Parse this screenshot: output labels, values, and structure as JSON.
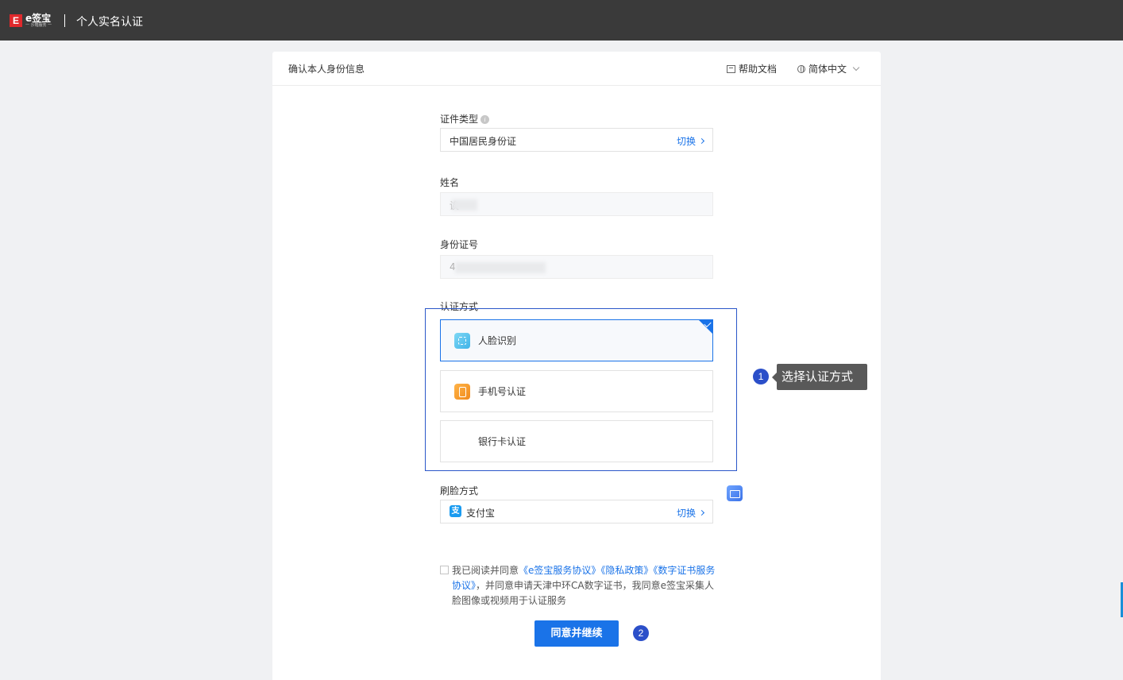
{
  "topbar": {
    "logo_mark": "E",
    "logo_name": "e签宝",
    "logo_sub": "一 沙箱服务 一",
    "title": "个人实名认证"
  },
  "card": {
    "title": "确认本人身份信息",
    "help_label": "帮助文档",
    "lang_label": "简体中文"
  },
  "form": {
    "id_type": {
      "label": "证件类型",
      "value": "中国居民身份证",
      "switch_label": "切换"
    },
    "name": {
      "label": "姓名",
      "value": "诶"
    },
    "id_number": {
      "label": "身份证号",
      "value": "4"
    },
    "auth_method": {
      "label": "认证方式",
      "options": [
        {
          "label": "人脸识别",
          "icon": "face-scan-icon",
          "selected": true
        },
        {
          "label": "手机号认证",
          "icon": "phone-icon",
          "selected": false
        },
        {
          "label": "银行卡认证",
          "icon": "bank-card-icon",
          "selected": false
        }
      ]
    },
    "face_method": {
      "label": "刷脸方式",
      "value": "支付宝",
      "switch_label": "切换"
    }
  },
  "agreement": {
    "checked": false,
    "prefix": "我已阅读并同意",
    "link1": "《e签宝服务协议》",
    "link2": "《隐私政策》",
    "link3": "《数字证书服务协议》",
    "suffix": "，并同意申请天津中环CA数字证书，我同意e签宝采集人脸图像或视频用于认证服务"
  },
  "submit_label": "同意并继续",
  "annotations": {
    "step1_num": "1",
    "step1_text": "选择认证方式",
    "step2_num": "2"
  },
  "colors": {
    "topbar": "#3a3a3a",
    "accent": "#1a73e8",
    "annotation": "#2b4fc9",
    "tooltip": "#595959"
  }
}
